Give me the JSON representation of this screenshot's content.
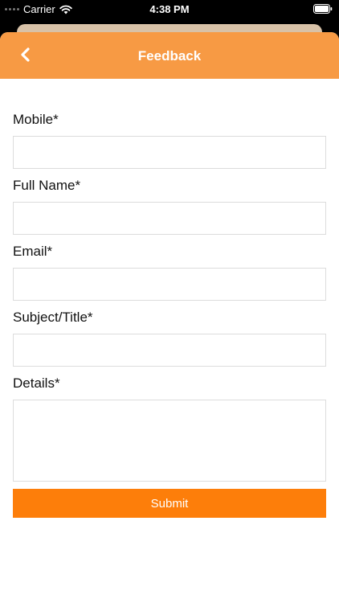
{
  "status_bar": {
    "carrier": "Carrier",
    "time": "4:38 PM"
  },
  "header": {
    "title": "Feedback",
    "back_icon": "chevron-left-icon"
  },
  "form": {
    "fields": [
      {
        "label": "Mobile*",
        "value": "",
        "placeholder": ""
      },
      {
        "label": "Full Name*",
        "value": "",
        "placeholder": ""
      },
      {
        "label": "Email*",
        "value": "",
        "placeholder": ""
      },
      {
        "label": "Subject/Title*",
        "value": "",
        "placeholder": ""
      },
      {
        "label": "Details*",
        "value": "",
        "placeholder": ""
      }
    ],
    "submit_label": "Submit"
  },
  "colors": {
    "header": "#f79a44",
    "submit": "#fd7e0a",
    "background_sheet": "#d8c2a8"
  }
}
